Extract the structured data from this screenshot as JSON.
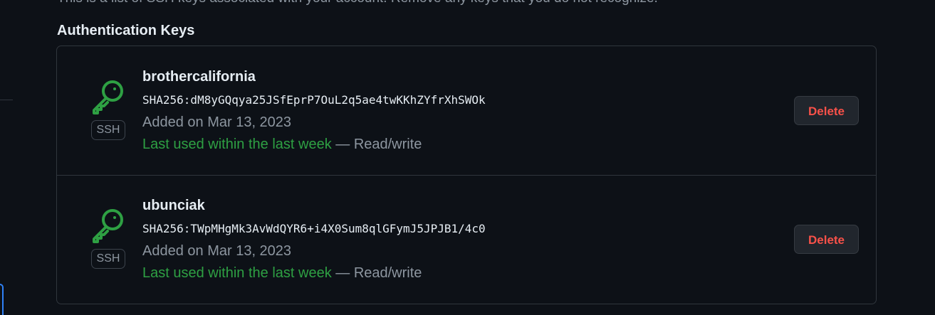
{
  "intro_text": "This is a list of SSH keys associated with your account. Remove any keys that you do not recognize.",
  "section_title": "Authentication Keys",
  "keys": [
    {
      "title": "brothercalifornia",
      "fingerprint": "SHA256:dM8yGQqya25JSfEprP7OuL2q5ae4twKKhZYfrXhSWOk",
      "added": "Added on Mar 13, 2023",
      "last_used": "Last used within the last week",
      "access": " — Read/write",
      "type_badge": "SSH",
      "icon": "key-icon",
      "delete_label": "Delete"
    },
    {
      "title": "ubunciak",
      "fingerprint": "SHA256:TWpMHgMk3AvWdQYR6+i4X0Sum8qlGFymJ5JPJB1/4c0",
      "added": "Added on Mar 13, 2023",
      "last_used": "Last used within the last week",
      "access": " — Read/write",
      "type_badge": "SSH",
      "icon": "key-icon",
      "delete_label": "Delete"
    }
  ],
  "colors": {
    "background": "#0d1117",
    "border": "#30363d",
    "text": "#e6edf3",
    "muted": "#8d96a0",
    "success": "#2ea043",
    "danger": "#f85149",
    "button_bg": "#21262d",
    "focus": "#2f81f7"
  }
}
